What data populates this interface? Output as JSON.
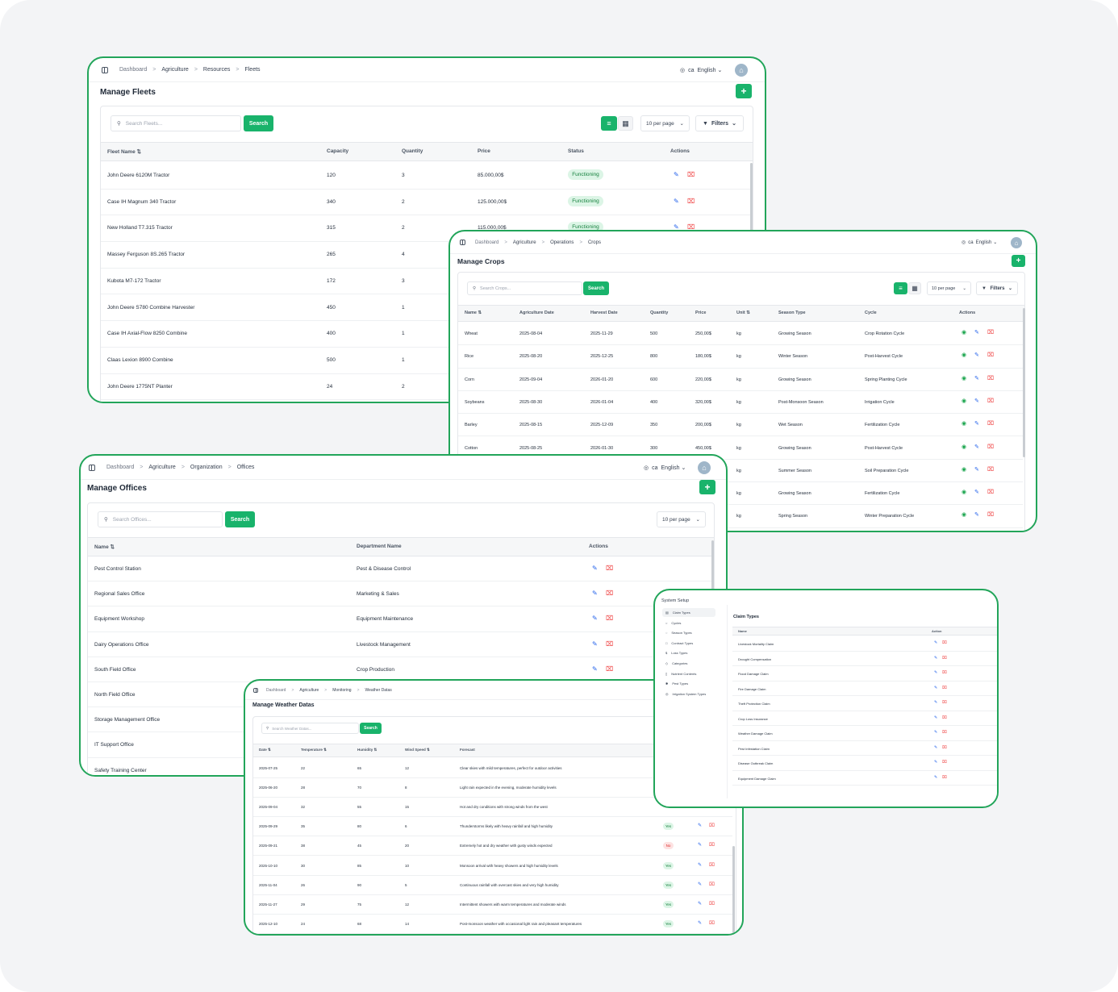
{
  "breadcrumb_sep": ">",
  "lang": {
    "code": "ca",
    "label": "English"
  },
  "avatar_text": "⌂",
  "add_symbol": "+",
  "search_button": "Search",
  "per_page": "10 per page",
  "filters": "Filters",
  "sort_icon": "⇅",
  "colors": {
    "brand": "#19b36b",
    "border": "#22a55a",
    "edit": "#2563eb",
    "delete": "#ef4444",
    "view": "#16a34a"
  },
  "icons": {
    "edit": "edit-icon",
    "delete": "trash-icon",
    "view": "eye-icon",
    "search": "search-icon",
    "globe": "globe-icon"
  },
  "fleets": {
    "breadcrumb": [
      "Dashboard",
      "Agriculture",
      "Resources",
      "Fleets"
    ],
    "title": "Manage Fleets",
    "search_placeholder": "Search Fleets...",
    "columns": [
      "Fleet Name",
      "Capacity",
      "Quantity",
      "Price",
      "Status",
      "Actions"
    ],
    "rows": [
      {
        "name": "John Deere 6120M Tractor",
        "capacity": "120",
        "quantity": "3",
        "price": "85.000,00$",
        "status": "Functioning"
      },
      {
        "name": "Case IH Magnum 340 Tractor",
        "capacity": "340",
        "quantity": "2",
        "price": "125.000,00$",
        "status": "Functioning"
      },
      {
        "name": "New Holland T7.315 Tractor",
        "capacity": "315",
        "quantity": "2",
        "price": "115.000,00$",
        "status": "Functioning"
      },
      {
        "name": "Massey Ferguson 8S.265 Tractor",
        "capacity": "265",
        "quantity": "4",
        "price": "",
        "status": ""
      },
      {
        "name": "Kubota M7-172 Tractor",
        "capacity": "172",
        "quantity": "3",
        "price": "",
        "status": ""
      },
      {
        "name": "John Deere S780 Combine Harvester",
        "capacity": "450",
        "quantity": "1",
        "price": "",
        "status": ""
      },
      {
        "name": "Case IH Axial-Flow 8250 Combine",
        "capacity": "400",
        "quantity": "1",
        "price": "",
        "status": ""
      },
      {
        "name": "Claas Lexion 8900 Combine",
        "capacity": "500",
        "quantity": "1",
        "price": "",
        "status": ""
      },
      {
        "name": "John Deere 1775NT Planter",
        "capacity": "24",
        "quantity": "2",
        "price": "",
        "status": ""
      }
    ]
  },
  "crops": {
    "breadcrumb": [
      "Dashboard",
      "Agriculture",
      "Operations",
      "Crops"
    ],
    "title": "Manage Crops",
    "search_placeholder": "Search Crops...",
    "columns": [
      "Name",
      "Agriculture Date",
      "Harvest Date",
      "Quantity",
      "Price",
      "Unit",
      "Season Type",
      "Cycle",
      "Actions"
    ],
    "rows": [
      {
        "name": "Wheat",
        "agri": "2025-08-04",
        "harvest": "2025-11-29",
        "qty": "500",
        "price": "250,00$",
        "unit": "kg",
        "season": "Growing Season",
        "cycle": "Crop Rotation Cycle"
      },
      {
        "name": "Rice",
        "agri": "2025-08-20",
        "harvest": "2025-12-25",
        "qty": "800",
        "price": "180,00$",
        "unit": "kg",
        "season": "Winter Season",
        "cycle": "Post-Harvest Cycle"
      },
      {
        "name": "Corn",
        "agri": "2025-09-04",
        "harvest": "2026-01-20",
        "qty": "600",
        "price": "220,00$",
        "unit": "kg",
        "season": "Growing Season",
        "cycle": "Spring Planting Cycle"
      },
      {
        "name": "Soybeans",
        "agri": "2025-08-30",
        "harvest": "2026-01-04",
        "qty": "400",
        "price": "320,00$",
        "unit": "kg",
        "season": "Post-Monsoon Season",
        "cycle": "Irrigation Cycle"
      },
      {
        "name": "Barley",
        "agri": "2025-08-15",
        "harvest": "2025-12-09",
        "qty": "350",
        "price": "200,00$",
        "unit": "kg",
        "season": "Wet Season",
        "cycle": "Fertilization Cycle"
      },
      {
        "name": "Cotton",
        "agri": "2025-08-25",
        "harvest": "2026-01-30",
        "qty": "300",
        "price": "450,00$",
        "unit": "kg",
        "season": "Growing Season",
        "cycle": "Post-Harvest Cycle"
      },
      {
        "name": "",
        "agri": "",
        "harvest": "",
        "qty": "",
        "price": "",
        "unit": "kg",
        "season": "Summer Season",
        "cycle": "Soil Preparation Cycle"
      },
      {
        "name": "",
        "agri": "",
        "harvest": "",
        "qty": "",
        "price": "",
        "unit": "kg",
        "season": "Growing Season",
        "cycle": "Fertilization Cycle"
      },
      {
        "name": "",
        "agri": "",
        "harvest": "",
        "qty": "",
        "price": "",
        "unit": "kg",
        "season": "Spring Season",
        "cycle": "Winter Preparation Cycle"
      }
    ]
  },
  "offices": {
    "breadcrumb": [
      "Dashboard",
      "Agriculture",
      "Organization",
      "Offices"
    ],
    "title": "Manage Offices",
    "search_placeholder": "Search Offices...",
    "columns": [
      "Name",
      "Department Name",
      "Actions"
    ],
    "rows": [
      {
        "name": "Pest Control Station",
        "dept": "Pest & Disease Control"
      },
      {
        "name": "Regional Sales Office",
        "dept": "Marketing & Sales"
      },
      {
        "name": "Equipment Workshop",
        "dept": "Equipment Maintenance"
      },
      {
        "name": "Dairy Operations Office",
        "dept": "Livestock Management"
      },
      {
        "name": "South Field Office",
        "dept": "Crop Production"
      },
      {
        "name": "North Field Office",
        "dept": ""
      },
      {
        "name": "Storage Management Office",
        "dept": ""
      },
      {
        "name": "IT Support Office",
        "dept": ""
      },
      {
        "name": "Safety Training Center",
        "dept": ""
      }
    ]
  },
  "weather": {
    "breadcrumb": [
      "Dashboard",
      "Agriculture",
      "Monitoring",
      "Weather Datas"
    ],
    "title": "Manage Weather Datas",
    "search_placeholder": "Search Weather Datas...",
    "columns": [
      "Date",
      "Temperature",
      "Humidity",
      "Wind Speed",
      "Forecast"
    ],
    "rows": [
      {
        "date": "2025-07-25",
        "temp": "22",
        "hum": "65",
        "wind": "12",
        "forecast": "Clear skies with mild temperatures, perfect for outdoor activities",
        "flag": ""
      },
      {
        "date": "2025-06-20",
        "temp": "28",
        "hum": "70",
        "wind": "8",
        "forecast": "Light rain expected in the evening, moderate humidity levels",
        "flag": ""
      },
      {
        "date": "2025-09-04",
        "temp": "32",
        "hum": "55",
        "wind": "15",
        "forecast": "Hot and dry conditions with strong winds from the west",
        "flag": ""
      },
      {
        "date": "2025-09-29",
        "temp": "35",
        "hum": "80",
        "wind": "6",
        "forecast": "Thunderstorms likely with heavy rainfall and high humidity",
        "flag": "Yes"
      },
      {
        "date": "2025-09-21",
        "temp": "38",
        "hum": "45",
        "wind": "20",
        "forecast": "Extremely hot and dry weather with gusty winds expected",
        "flag": "No"
      },
      {
        "date": "2025-10-10",
        "temp": "30",
        "hum": "85",
        "wind": "10",
        "forecast": "Monsoon arrival with heavy showers and high humidity levels",
        "flag": "Yes"
      },
      {
        "date": "2025-11-04",
        "temp": "26",
        "hum": "90",
        "wind": "5",
        "forecast": "Continuous rainfall with overcast skies and very high humidity",
        "flag": "Yes"
      },
      {
        "date": "2025-11-27",
        "temp": "29",
        "hum": "75",
        "wind": "12",
        "forecast": "Intermittent showers with warm temperatures and moderate winds",
        "flag": "Yes"
      },
      {
        "date": "2025-12-10",
        "temp": "24",
        "hum": "68",
        "wind": "14",
        "forecast": "Post-monsoon weather with occasional light rain and pleasant temperatures",
        "flag": "Yes"
      }
    ]
  },
  "setup": {
    "sidebar_title": "System Setup",
    "sidebar": [
      {
        "label": "Claim Types",
        "icon": "▤"
      },
      {
        "label": "Cycles",
        "icon": "○"
      },
      {
        "label": "Season Types",
        "icon": "◌"
      },
      {
        "label": "Contract Types",
        "icon": "□"
      },
      {
        "label": "Loss Types",
        "icon": "$"
      },
      {
        "label": "Categories",
        "icon": "◇"
      },
      {
        "label": "Nutrient Contents",
        "icon": "▯"
      },
      {
        "label": "Pest Types",
        "icon": "✱"
      },
      {
        "label": "Irrigation System Types",
        "icon": "◎"
      }
    ],
    "panel_title": "Claim Types",
    "columns": [
      "Name",
      "Action"
    ],
    "rows": [
      "Livestock Mortality Claim",
      "Drought Compensation",
      "Flood Damage Claim",
      "Fire Damage Claim",
      "Theft Protection Claim",
      "Crop Loss Insurance",
      "Weather Damage Claim",
      "Pest Infestation Claim",
      "Disease Outbreak Claim",
      "Equipment Damage Claim"
    ]
  }
}
